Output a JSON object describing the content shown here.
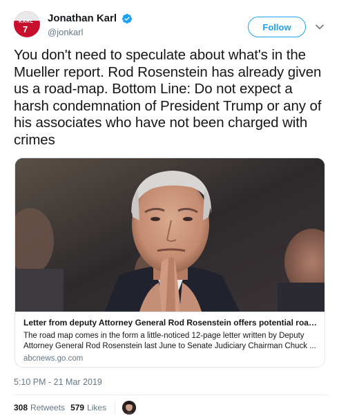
{
  "author": {
    "display_name": "Jonathan Karl",
    "handle": "@jonkarl",
    "verified": true,
    "verified_icon": "verified-badge-icon",
    "avatar_jersey_text": "KARL",
    "avatar_jersey_number": "7"
  },
  "actions": {
    "follow_label": "Follow",
    "more_icon": "chevron-down-icon"
  },
  "tweet": {
    "text": "You don't need to speculate about what's in the Mueller report.  Rod Rosenstein has already given us a road-map. Bottom Line: Do not expect a harsh condemnation of President Trump or any of his associates who have not been charged with crimes"
  },
  "card": {
    "title": "Letter from deputy Attorney General Rod Rosenstein offers potential road ma...",
    "description": "The road map comes in the form a little-noticed 12-page letter written by Deputy Attorney General Rod Rosenstein last June to Senate Judiciary Chairman Chuck ...",
    "domain": "abcnews.go.com"
  },
  "meta": {
    "timestamp": "5:10 PM - 21 Mar 2019"
  },
  "stats": {
    "retweets_count": "308",
    "retweets_label": "Retweets",
    "likes_count": "579",
    "likes_label": "Likes"
  },
  "colors": {
    "accent": "#1da1f2",
    "text_primary": "#14171a",
    "text_secondary": "#657786",
    "border": "#e1e8ed"
  }
}
